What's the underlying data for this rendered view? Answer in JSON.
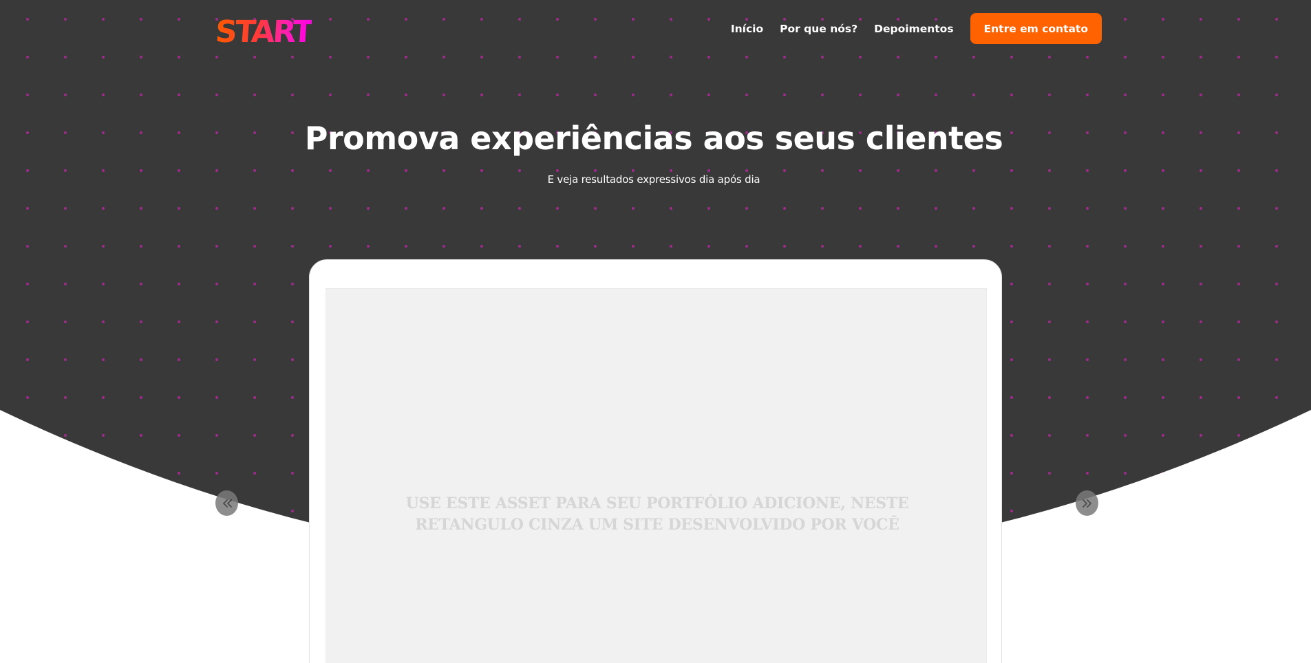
{
  "header": {
    "logo_text": "START",
    "nav": [
      {
        "label": "Início"
      },
      {
        "label": "Por que nós?"
      },
      {
        "label": "Depoimentos"
      }
    ],
    "cta_label": "Entre em contato"
  },
  "hero": {
    "title": "Promova experiências aos seus clientes",
    "subtitle": "E veja resultados expressivos dia após dia"
  },
  "showcase": {
    "placeholder_line1": "USE ESTE ASSET PARA SEU PORTFÓLIO ADICIONE, NESTE",
    "placeholder_line2": "RETANGULO CINZA UM SITE DESENVOLVIDO POR VOCÊ",
    "prev_icon": "double-chevron-left-icon",
    "next_icon": "double-chevron-right-icon"
  },
  "colors": {
    "hero_background": "#3a393a",
    "dot_pattern": "#b0279a",
    "accent": "#ff6200",
    "logo_gradient_start": "#ff5a00",
    "logo_gradient_end": "#ff00e6",
    "screen_placeholder": "#f1f1f1"
  }
}
